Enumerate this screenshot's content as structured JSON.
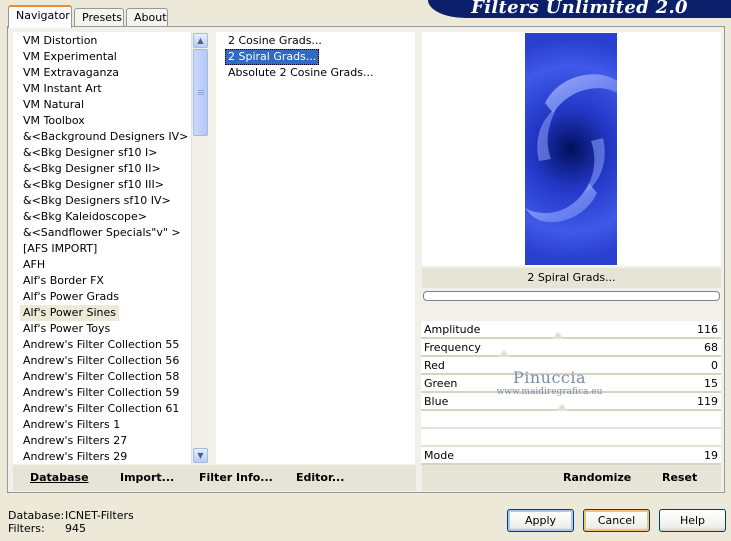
{
  "tabs": [
    "Navigator",
    "Presets",
    "About"
  ],
  "title": "Filters Unlimited 2.0",
  "categories": [
    "VM Distortion",
    "VM Experimental",
    "VM Extravaganza",
    "VM Instant Art",
    "VM Natural",
    "VM Toolbox",
    "&<Background Designers IV>",
    "&<Bkg Designer sf10 I>",
    "&<Bkg Designer sf10 II>",
    "&<Bkg Designer sf10 III>",
    "&<Bkg Designers sf10 IV>",
    "&<Bkg Kaleidoscope>",
    "&<Sandflower Specials\"v\" >",
    "[AFS IMPORT]",
    "AFH",
    "Alf's Border FX",
    "Alf's Power Grads",
    "Alf's Power Sines",
    "Alf's Power Toys",
    "Andrew's Filter Collection 55",
    "Andrew's Filter Collection 56",
    "Andrew's Filter Collection 58",
    "Andrew's Filter Collection 59",
    "Andrew's Filter Collection 61",
    "Andrew's Filters 1",
    "Andrew's Filters 27",
    "Andrew's Filters 29"
  ],
  "selected_category": "Alf's Power Sines",
  "filters": [
    "2 Cosine Grads...",
    "2 Spiral Grads...",
    "Absolute 2 Cosine Grads..."
  ],
  "selected_filter": "2 Spiral Grads...",
  "preview_label": "2 Spiral Grads...",
  "params": [
    {
      "name": "Amplitude",
      "value": "116",
      "level": 0.455
    },
    {
      "name": "Frequency",
      "value": "68",
      "level": 0.267
    },
    {
      "name": "Red",
      "value": "0",
      "level": null
    },
    {
      "name": "Green",
      "value": "15",
      "level": null
    },
    {
      "name": "Blue",
      "value": "119",
      "level": 0.467
    },
    {
      "name": "",
      "value": "",
      "level": null
    },
    {
      "name": "",
      "value": "",
      "level": null
    },
    {
      "name": "Mode",
      "value": "19",
      "level": null
    }
  ],
  "watermark": {
    "main": "Pinuccia",
    "sub": "www.maidiregrafica.eu"
  },
  "left_bar": {
    "database": "Database",
    "import": "Import...",
    "filter_info": "Filter Info...",
    "editor": "Editor..."
  },
  "right_bar": {
    "randomize": "Randomize",
    "reset": "Reset"
  },
  "footer": {
    "database_label": "Database:",
    "database_value": "ICNET-Filters",
    "filters_label": "Filters:",
    "filters_value": "945"
  },
  "buttons": {
    "apply": "Apply",
    "cancel": "Cancel",
    "help": "Help"
  },
  "colors": {
    "selection": "#316ac5",
    "banner": "#0b1f6b",
    "preview_blue": "#2a3fd0"
  }
}
